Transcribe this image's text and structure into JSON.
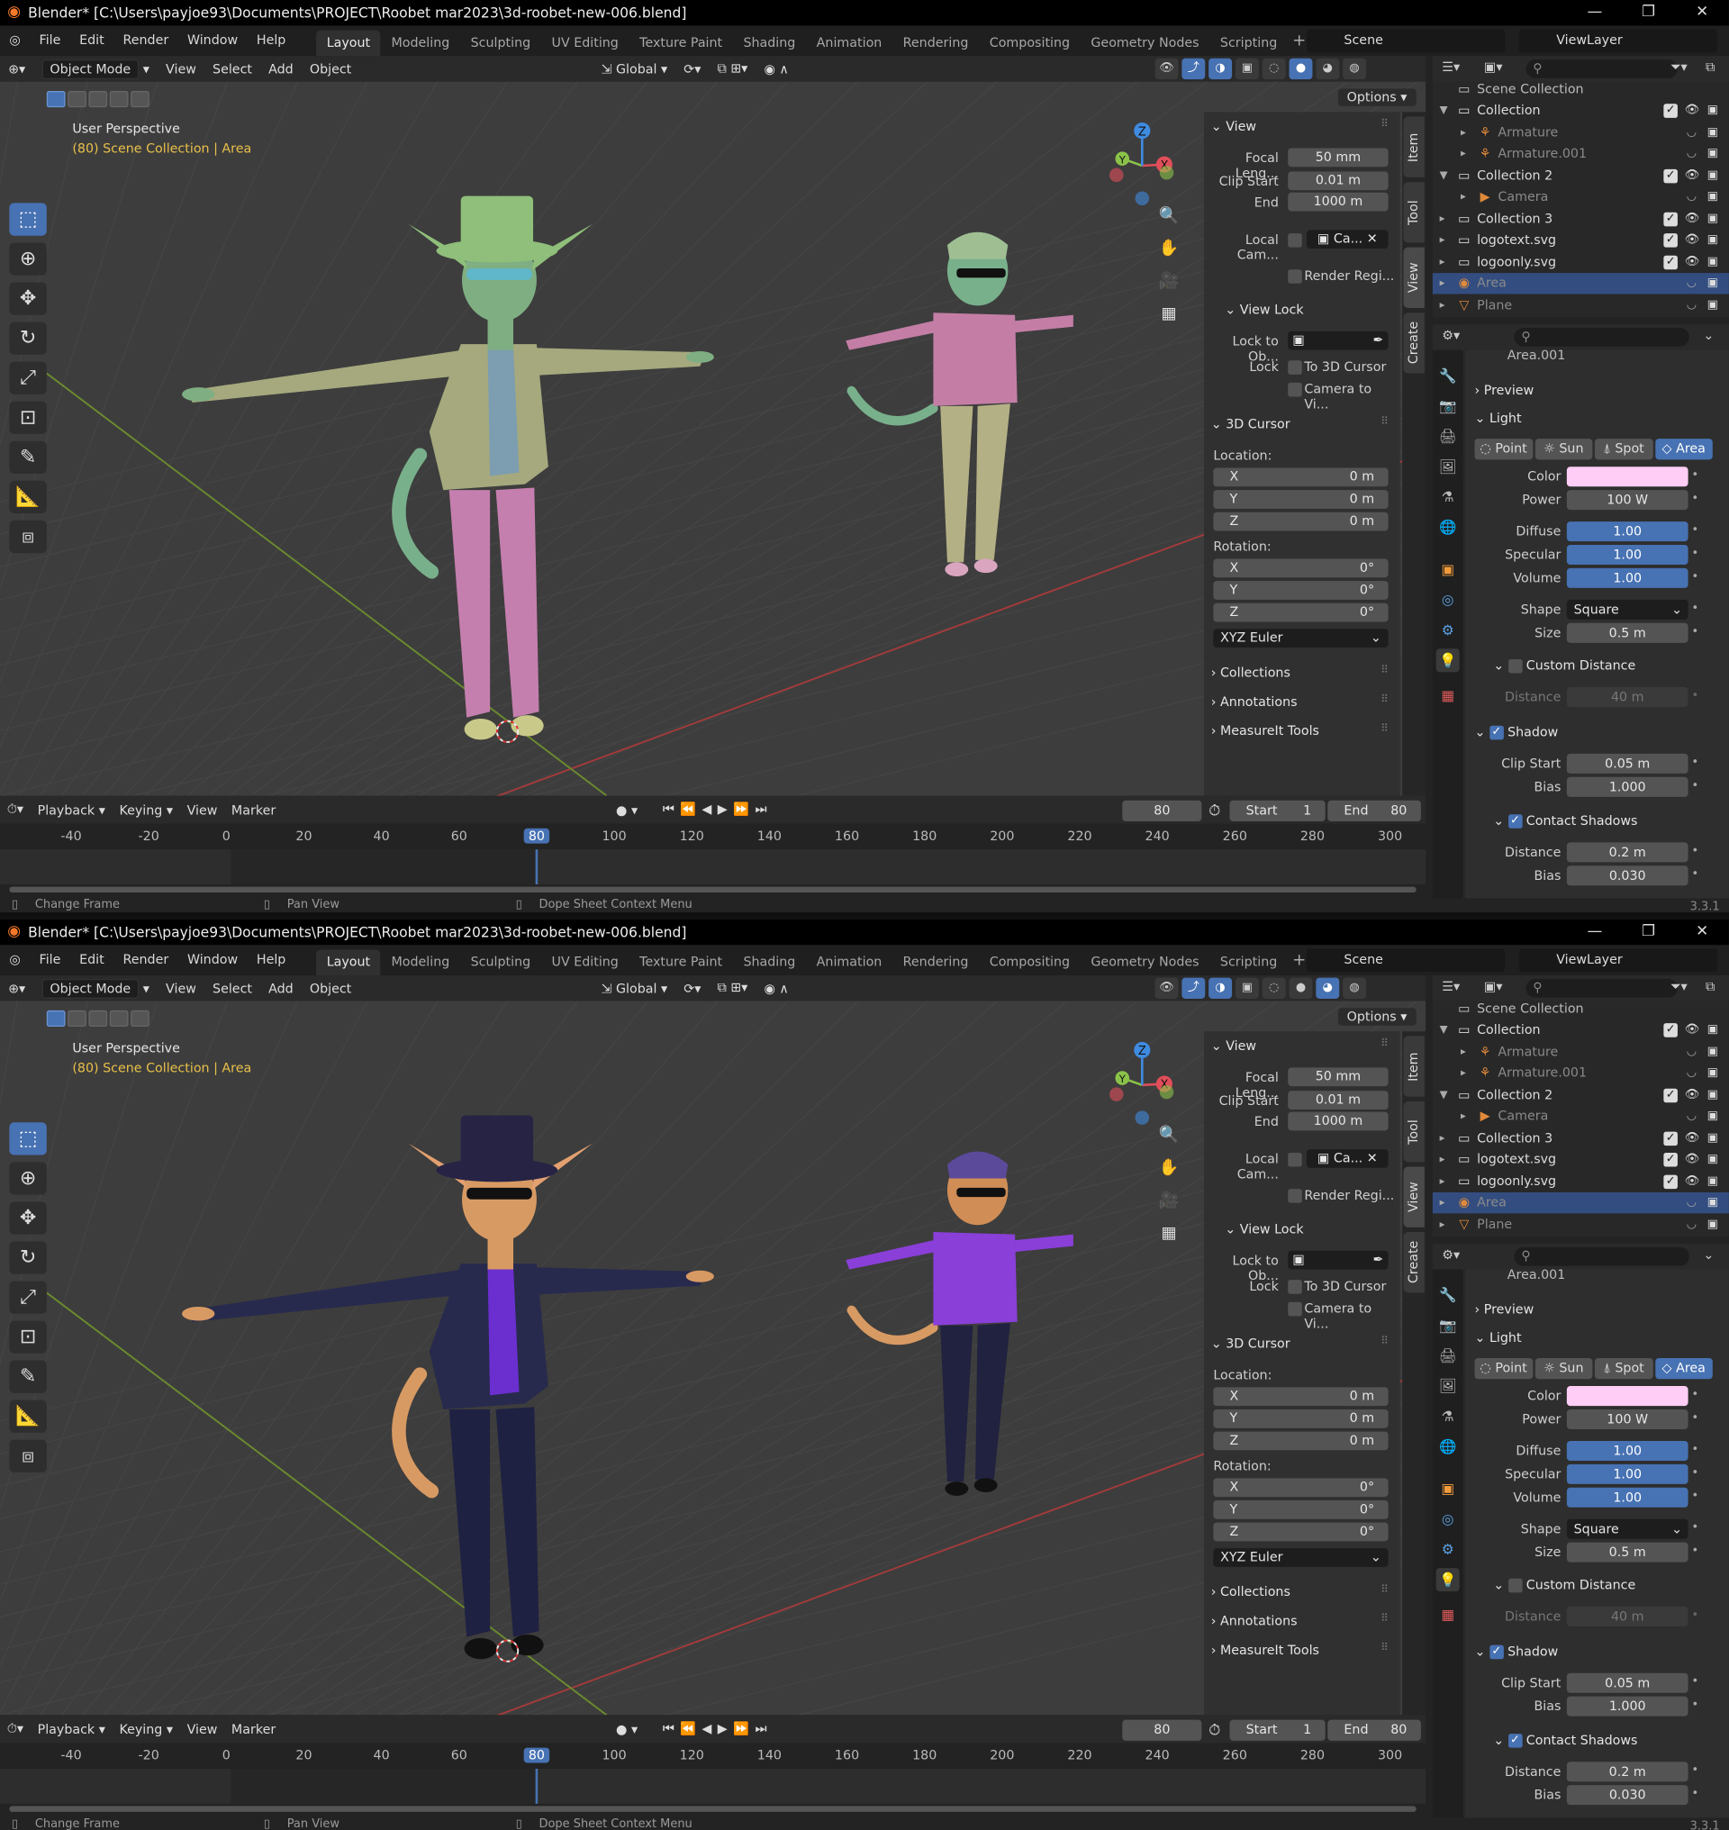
{
  "title": "Blender* [C:\\Users\\payjoe93\\Documents\\PROJECT\\Roobet mar2023\\3d-roobet-new-006.blend]",
  "menus": [
    "File",
    "Edit",
    "Render",
    "Window",
    "Help"
  ],
  "workspaces": [
    "Layout",
    "Modeling",
    "Sculpting",
    "UV Editing",
    "Texture Paint",
    "Shading",
    "Animation",
    "Rendering",
    "Compositing",
    "Geometry Nodes",
    "Scripting"
  ],
  "plus": "+",
  "scene": "Scene",
  "view_layer": "ViewLayer",
  "header": {
    "mode": "Object Mode",
    "view": "View",
    "select": "Select",
    "add": "Add",
    "object": "Object",
    "transform": "Global"
  },
  "viewport": {
    "perspective": "User Perspective",
    "collection": "(80) Scene Collection | Area",
    "options": "Options"
  },
  "gizmo": {
    "x": "X",
    "y": "Y",
    "z": "Z"
  },
  "npanel": {
    "view": "View",
    "focal_label": "Focal Leng...",
    "focal": "50 mm",
    "clip_start_label": "Clip Start",
    "clip_start": "0.01 m",
    "end_label": "End",
    "end": "1000 m",
    "local_cam": "Local Cam...",
    "local_cam_val": "Ca...",
    "render_region": "Render Regi...",
    "view_lock": "View Lock",
    "lock_obj": "Lock to Ob...",
    "lock": "Lock",
    "to_cursor": "To 3D Cursor",
    "camera_to": "Camera to Vi...",
    "cursor": "3D Cursor",
    "location": "Location:",
    "x": "X",
    "y": "Y",
    "z": "Z",
    "zero_m": "0 m",
    "rotation": "Rotation:",
    "zero_deg": "0°",
    "euler": "XYZ Euler",
    "collections": "Collections",
    "annotations": "Annotations",
    "measureit": "MeasureIt Tools"
  },
  "vtabs": [
    "Item",
    "Tool",
    "View",
    "Create"
  ],
  "timeline": {
    "playback": "Playback",
    "keying": "Keying",
    "view": "View",
    "marker": "Marker",
    "frame": "80",
    "start_label": "Start",
    "start": "1",
    "end_label": "End",
    "end": "80",
    "ticks": [
      "-40",
      "-20",
      "0",
      "20",
      "40",
      "60",
      "80",
      "100",
      "120",
      "140",
      "160",
      "180",
      "200",
      "220",
      "240",
      "260",
      "280",
      "300"
    ]
  },
  "status": {
    "change_frame": "Change Frame",
    "pan_view": "Pan View",
    "dope_menu": "Dope Sheet Context Menu",
    "version": "3.3.1"
  },
  "outliner": {
    "root": "Scene Collection",
    "items": [
      {
        "name": "Collection",
        "level": 1
      },
      {
        "name": "Armature",
        "level": 2
      },
      {
        "name": "Armature.001",
        "level": 2
      },
      {
        "name": "Collection 2",
        "level": 1
      },
      {
        "name": "Camera",
        "level": 2
      },
      {
        "name": "Collection 3",
        "level": 1
      },
      {
        "name": "logotext.svg",
        "level": 1
      },
      {
        "name": "logoonly.svg",
        "level": 1
      },
      {
        "name": "Area",
        "level": 1
      },
      {
        "name": "Plane",
        "level": 1
      }
    ]
  },
  "props": {
    "object": "Area.001",
    "preview": "Preview",
    "light": "Light",
    "types": [
      "Point",
      "Sun",
      "Spot",
      "Area"
    ],
    "color_label": "Color",
    "power_label": "Power",
    "power": "100 W",
    "diffuse_label": "Diffuse",
    "diffuse": "1.00",
    "specular_label": "Specular",
    "specular": "1.00",
    "volume_label": "Volume",
    "volume": "1.00",
    "shape_label": "Shape",
    "shape": "Square",
    "size_label": "Size",
    "size": "0.5 m",
    "custom_distance": "Custom Distance",
    "distance_label": "Distance",
    "distance": "40 m",
    "shadow": "Shadow",
    "clip_start_label": "Clip Start",
    "clip_start": "0.05 m",
    "bias_label": "Bias",
    "bias": "1.000",
    "contact_shadows": "Contact Shadows",
    "c_distance": "0.2 m",
    "c_bias": "0.030"
  },
  "colors": {
    "accent": "#4772b3",
    "light_color": "#ffcdf5",
    "cursor_text": "#e8c04a"
  }
}
